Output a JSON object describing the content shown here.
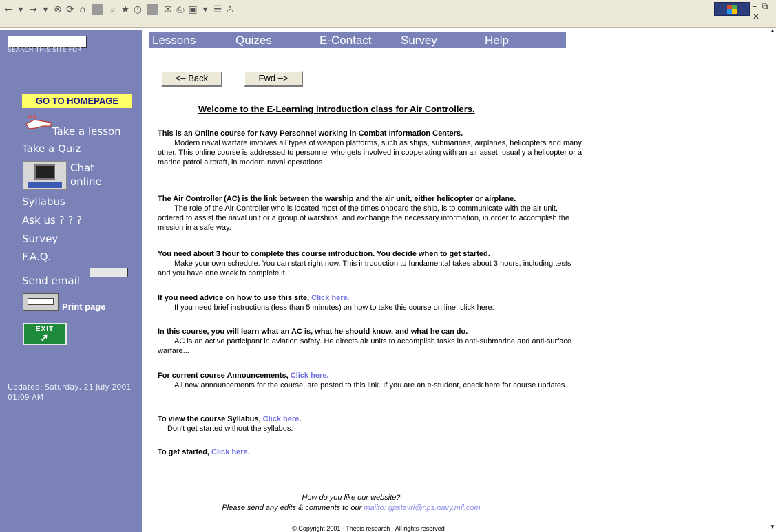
{
  "toolbar": {
    "icons": [
      "back-icon",
      "dropdown-icon",
      "forward-icon",
      "dropdown-icon",
      "stop-icon",
      "refresh-icon",
      "home-icon",
      "search-icon",
      "favorites-icon",
      "history-icon",
      "mail-icon",
      "print-icon",
      "edit-icon",
      "discuss-icon",
      "messenger-icon"
    ],
    "win_controls": "– ⧉ ✕"
  },
  "sidebar": {
    "search_label": "SEARCH THIS SITE FOR",
    "home_label": "GO TO HOMEPAGE",
    "take_lesson": "Take a lesson",
    "take_quiz": "Take a Quiz",
    "chat_line1": "Chat",
    "chat_line2": "online",
    "syllabus": "Syllabus",
    "ask_us": "Ask us ? ? ?",
    "survey": "Survey",
    "faq": "F.A.Q.",
    "send_email": "Send email",
    "print_page": "Print page",
    "exit_label": "EXIT",
    "updated": "Updated: Saturday, 21 July 2001 01:09 AM"
  },
  "topnav": {
    "lessons": "Lessons",
    "quizes": "Quizes",
    "econtact": "E-Contact",
    "survey": "Survey",
    "help": "Help"
  },
  "buttons": {
    "back": "<– Back",
    "fwd": "Fwd –>"
  },
  "content": {
    "welcome": "Welcome to the E-Learning introduction class for Air Controllers.",
    "s1_head": "This is an Online course for Navy Personnel working in Combat Information Centers.",
    "s1_body": "Modern naval warfare involves all types of weapon platforms, such as ships, submarines, airplanes, helicopters and many other. This online course is addressed to personnel who gets involved in cooperating with an air asset, usually a helicopter or a marine patrol aircraft, in modern naval operations.",
    "s2_head": "The Air Controller (AC) is the link between the warship and the air unit, either helicopter or airplane.",
    "s2_body": "The role of the Air Controller who is located most of the times onboard the ship, is to communicate with the air unit, ordered to assist the naval unit or a group of warships, and exchange the necessary information, in order to accomplish the mission in a safe way.",
    "s3_head": "You need about 3 hour to complete this course introduction. You decide when to get started.",
    "s3_body": "Make your own schedule. You can start right now. This introduction to fundamental takes about 3 hours, including tests and you have one week to complete it.",
    "s4_head": "If you need advice on how to use this site,",
    "s4_link": "Click here.",
    "s4_body": "If you need brief instructions (less than 5 minutes) on how to take this course on line, click here.",
    "s5_head": "In  this course, you will learn what an AC is, what he should know, and what he can do.",
    "s5_body": "AC is an active participant in aviation safety. He directs air units to accomplish tasks in anti-submarine and anti-surface warfare...",
    "s6_head": "For current course Announcements,",
    "s6_link": "Click here.",
    "s6_body": "All new announcements for the course, are posted to this link. If you are an e-student, check here for course updates.",
    "s7_head": "To view the course Syllabus,",
    "s7_link": "Click here",
    "s7_dot": ".",
    "s7_body": "Don't get started without the syllabus.",
    "s8_head": "To get started,",
    "s8_link": "Click here."
  },
  "footer": {
    "question": "How do you like our website?",
    "edits": "Please send any edits & comments to our",
    "mailto": "mailto: gpstavri@nps.navy.mil.com",
    "copyright": "© Copyright 2001 - Thesis research - All rights reserved"
  },
  "colors": {
    "sidebar": "#7b82b8",
    "home_button": "#ffff66",
    "link": "#6f6fe0"
  }
}
